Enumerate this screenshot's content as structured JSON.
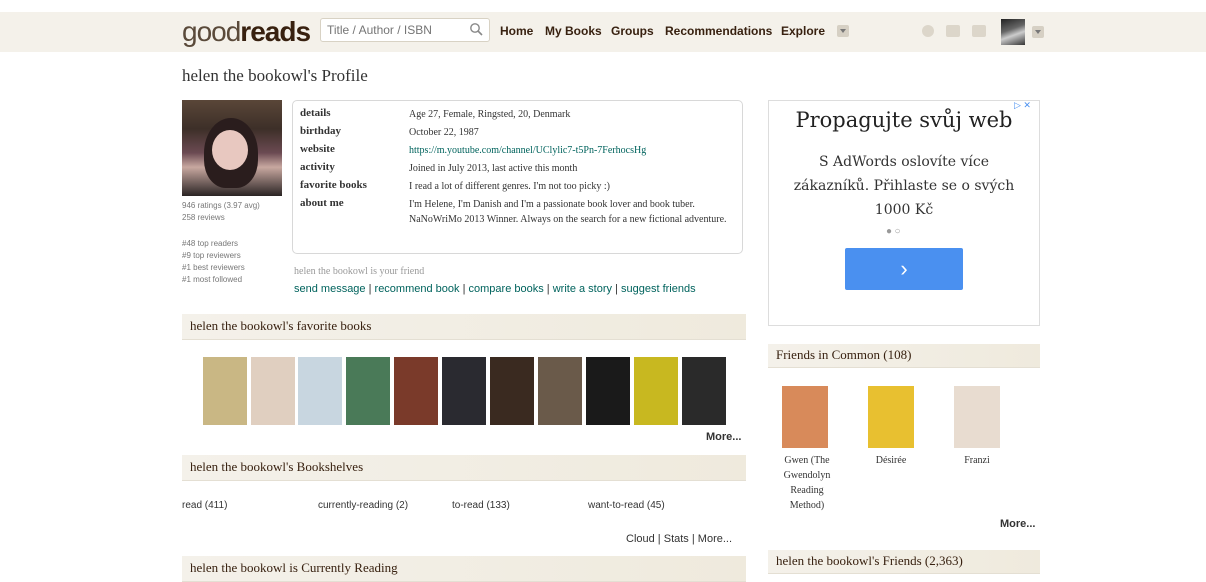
{
  "header": {
    "logo_light": "good",
    "logo_bold": "reads",
    "search_placeholder": "Title / Author / ISBN",
    "nav": [
      "Home",
      "My Books",
      "Groups",
      "Recommendations",
      "Explore"
    ]
  },
  "profile": {
    "title": "helen the bookowl's Profile",
    "stats": [
      "946 ratings (3.97 avg)",
      "258 reviews",
      "#48 top readers",
      "#9 top reviewers",
      "#1 best reviewers",
      "#1 most followed"
    ],
    "details": [
      {
        "label": "details",
        "value": "Age 27, Female, Ringsted, 20, Denmark"
      },
      {
        "label": "birthday",
        "value": "October 22, 1987"
      },
      {
        "label": "website",
        "value": "https://m.youtube.com/channel/UClylic7-t5Pn-7FerhocsHg"
      },
      {
        "label": "activity",
        "value": "Joined in July 2013, last active this month"
      },
      {
        "label": "favorite books",
        "value": "I read a lot of different genres. I'm not too picky :)"
      },
      {
        "label": "about me",
        "value": "I'm Helene, I'm Danish and I'm a passionate book lover and book tuber. NaNoWriMo 2013 Winner. Always on the search for a new fictional adventure."
      }
    ],
    "friend_note": "helen the bookowl is your friend",
    "actions": [
      "send message",
      "recommend book",
      "compare books",
      "write a story",
      "suggest friends"
    ]
  },
  "favorites": {
    "header": "helen the bookowl's favorite books",
    "more": "More...",
    "book_colors": [
      "#c9b784",
      "#e0cfc0",
      "#c8d6e0",
      "#4a7a58",
      "#7a3a2a",
      "#2a2a30",
      "#3a2a20",
      "#6a5a4a",
      "#1a1a1a",
      "#c8b820",
      "#2a2a2a"
    ]
  },
  "shelves": {
    "header": "helen the bookowl's Bookshelves",
    "items": [
      "read (411)",
      "currently-reading (2)",
      "to-read (133)",
      "want-to-read (45)"
    ],
    "links": [
      "Cloud",
      "Stats",
      "More..."
    ]
  },
  "currently": {
    "header": "helen the bookowl is Currently Reading"
  },
  "ad": {
    "title": "Propagujte svůj web",
    "text": "S AdWords oslovíte více zákazníků. Přihlaste se o svých 1000 Kč",
    "dots": "● ○",
    "arrow": "›",
    "badge": "▷ ✕"
  },
  "friends_common": {
    "header": "Friends in Common (108)",
    "people": [
      {
        "name": "Gwen (The Gwendolyn Reading Method)",
        "color": "#d88a5a"
      },
      {
        "name": "Désirée",
        "color": "#e8c030"
      },
      {
        "name": "Franzi",
        "color": "#e8dcd0"
      }
    ],
    "more": "More..."
  },
  "friends": {
    "header": "helen the bookowl's Friends (2,363)"
  }
}
